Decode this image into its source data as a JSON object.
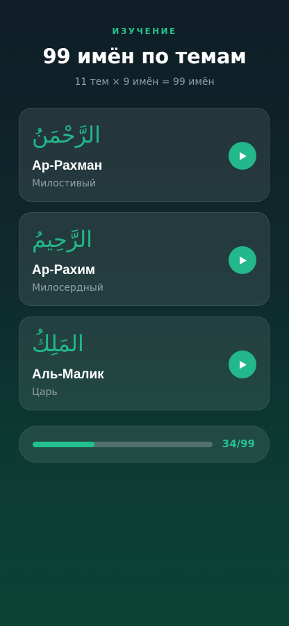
{
  "header": {
    "eyebrow": "ИЗУЧЕНИЕ",
    "title": "99 имён по темам",
    "subtitle": "11 тем × 9 имён = 99 имён"
  },
  "names": [
    {
      "arabic": "الرَّحْمَنُ",
      "name": "Ар-Рахман",
      "meaning": "Милостивый",
      "icon": "play-icon"
    },
    {
      "arabic": "الرَّحِيمُ",
      "name": "Ар-Рахим",
      "meaning": "Милосердный",
      "icon": "play-icon"
    },
    {
      "arabic": "المَلِكُ",
      "name": "Аль-Малик",
      "meaning": "Царь",
      "icon": "play-icon"
    }
  ],
  "progress": {
    "label": "34/99",
    "fraction": 0.3434
  },
  "colors": {
    "accent": "#22b88c",
    "muted_text": "#92a1a8"
  }
}
